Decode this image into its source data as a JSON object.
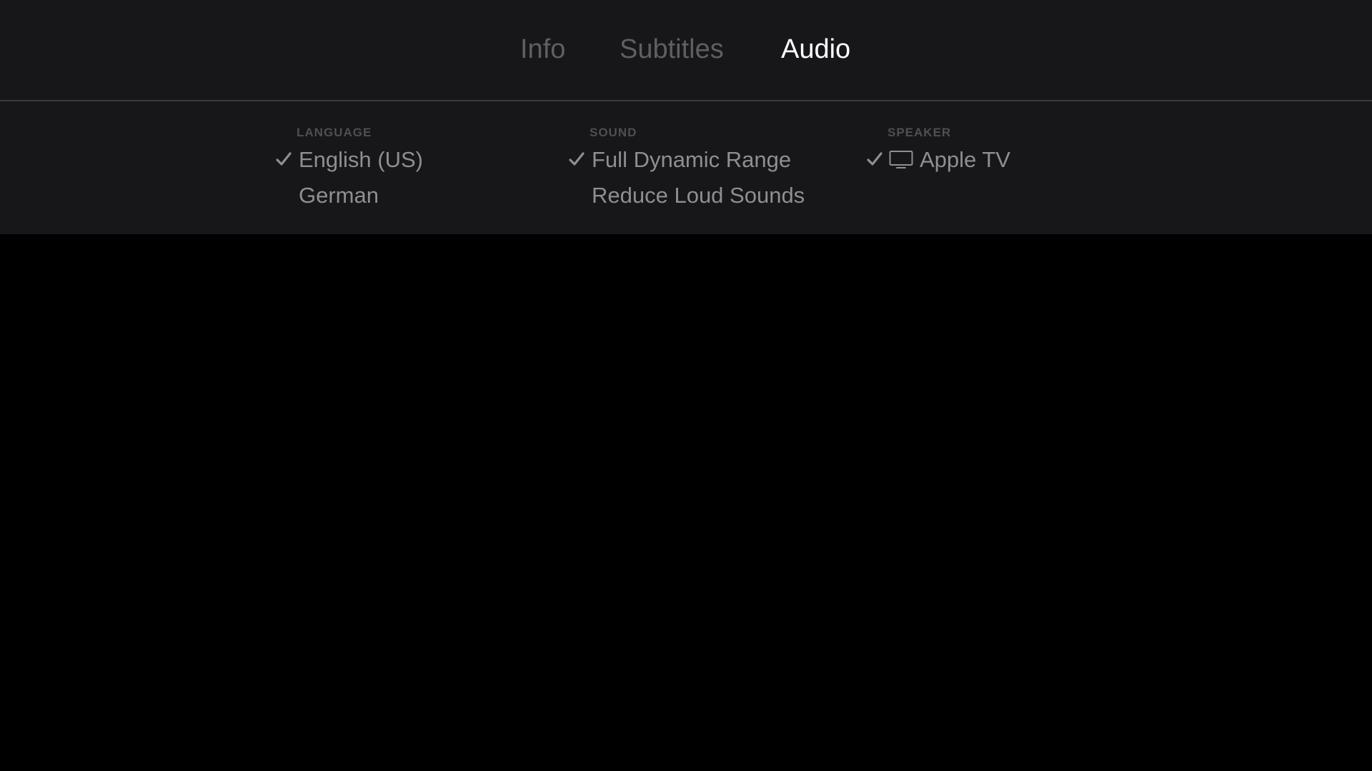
{
  "tabs": [
    {
      "label": "Info",
      "selected": false
    },
    {
      "label": "Subtitles",
      "selected": false
    },
    {
      "label": "Audio",
      "selected": true
    }
  ],
  "columns": {
    "language": {
      "header": "LANGUAGE",
      "options": [
        {
          "label": "English (US)",
          "checked": true
        },
        {
          "label": "German",
          "checked": false
        }
      ]
    },
    "sound": {
      "header": "SOUND",
      "options": [
        {
          "label": "Full Dynamic Range",
          "checked": true
        },
        {
          "label": "Reduce Loud Sounds",
          "checked": false
        }
      ]
    },
    "speaker": {
      "header": "SPEAKER",
      "options": [
        {
          "label": "Apple TV",
          "checked": true,
          "icon": "tv-icon"
        }
      ]
    }
  },
  "colors": {
    "panel_background": "#171719",
    "page_background": "#000000",
    "selected_tab": "#ffffff",
    "unselected_tab": "#5f5f63",
    "option_text": "#8e8e93",
    "header_text": "#4f4f53"
  }
}
